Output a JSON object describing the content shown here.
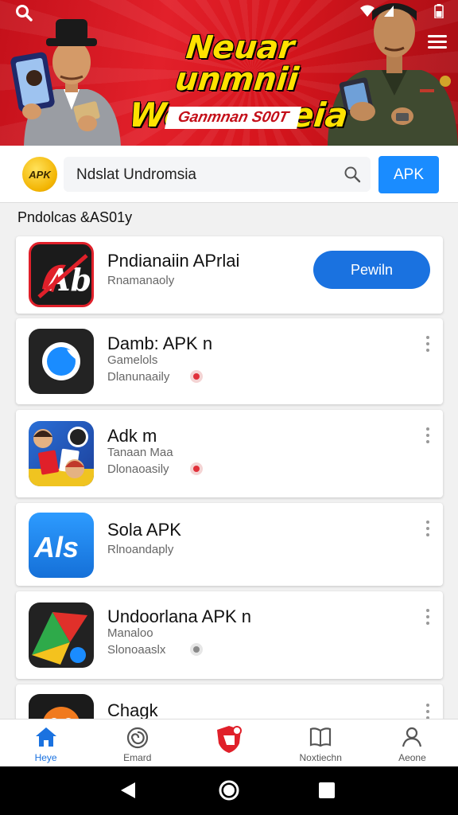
{
  "banner": {
    "title_line1": "Neuar unmnii",
    "title_line2": "Woonameia",
    "tagline": "Ganmnan S00T"
  },
  "search": {
    "query": "Ndslat Undromsia",
    "logo_text": "APK",
    "button_label": "APK"
  },
  "section_title": "Pndolcas &AS01y",
  "apps": [
    {
      "title": "Pndianaiin APrlai",
      "sub1": "Rnamanaoly",
      "action": "Pewiln",
      "icon": "apk-logo-red-icon"
    },
    {
      "title": "Damb: APK n",
      "sub1": "Gamelols",
      "sub2": "Dlanunaaily",
      "icon": "blue-circle-app-icon"
    },
    {
      "title": "Adk m",
      "sub1": "Tanaan Maa",
      "sub2": "Dlonaoasily",
      "icon": "cartoon-characters-app-icon"
    },
    {
      "title": "Sola APK",
      "sub1": "Rlnoandaply",
      "icon": "als-app-icon"
    },
    {
      "title": "Undoorlana APK n",
      "sub1": "Manaloo",
      "sub2": "Slonoaaslx",
      "icon": "colorful-shapes-app-icon"
    },
    {
      "title": "Chagk",
      "icon": "orange-character-app-icon"
    }
  ],
  "bottom_nav": [
    {
      "label": "Heye",
      "icon": "home-icon",
      "active": true
    },
    {
      "label": "Emard",
      "icon": "spiral-icon",
      "active": false
    },
    {
      "label": "",
      "icon": "shield-app-icon",
      "active": false
    },
    {
      "label": "Noxtiechn",
      "icon": "book-icon",
      "active": false
    },
    {
      "label": "Aeone",
      "icon": "person-icon",
      "active": false
    }
  ],
  "colors": {
    "banner_red": "#d6151d",
    "title_yellow": "#ffe200",
    "accent_blue": "#1a72e0",
    "apk_button_blue": "#1a8cff"
  }
}
